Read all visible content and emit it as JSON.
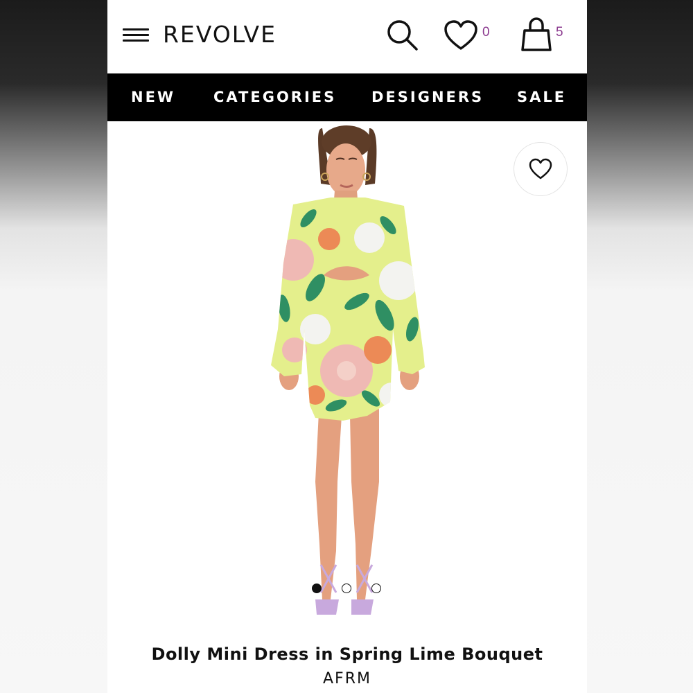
{
  "header": {
    "logo": "REVOLVE",
    "wishlist_count": "0",
    "bag_count": "5"
  },
  "nav": {
    "items": [
      {
        "label": "NEW"
      },
      {
        "label": "CATEGORIES"
      },
      {
        "label": "DESIGNERS"
      },
      {
        "label": "SALE"
      }
    ]
  },
  "product": {
    "image": "model-in-floral-mini-dress",
    "title": "Dolly Mini Dress in Spring Lime Bouquet",
    "brand": "AFRM",
    "carousel": {
      "count": 3,
      "active": 1
    }
  },
  "colors": {
    "nav_background": "#000000",
    "count_accent": "#8b3a8f",
    "dress_lime": "#e4ef8c",
    "dress_pink": "#efb9b4",
    "dress_green": "#2f8f63",
    "dress_orange": "#ec8a56"
  }
}
